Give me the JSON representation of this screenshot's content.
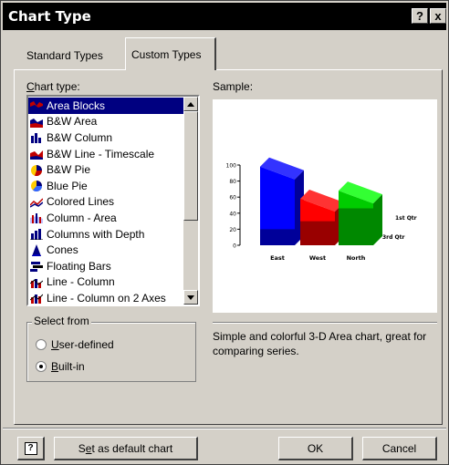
{
  "window": {
    "title": "Chart Type",
    "help_label": "?",
    "close_label": "x"
  },
  "tabs": [
    {
      "label": "Standard Types",
      "active": false
    },
    {
      "label": "Custom Types",
      "active": true
    }
  ],
  "chart_type_list": {
    "label_prefix": "C",
    "label_rest": "hart type:",
    "items": [
      {
        "label": "Area Blocks",
        "icon": "area-blocks-icon",
        "selected": true
      },
      {
        "label": "B&W Area",
        "icon": "bw-area-icon"
      },
      {
        "label": "B&W Column",
        "icon": "bw-column-icon"
      },
      {
        "label": "B&W Line - Timescale",
        "icon": "bw-line-timescale-icon"
      },
      {
        "label": "B&W Pie",
        "icon": "bw-pie-icon"
      },
      {
        "label": "Blue Pie",
        "icon": "blue-pie-icon"
      },
      {
        "label": "Colored Lines",
        "icon": "colored-lines-icon"
      },
      {
        "label": "Column - Area",
        "icon": "column-area-icon"
      },
      {
        "label": "Columns with Depth",
        "icon": "columns-depth-icon"
      },
      {
        "label": "Cones",
        "icon": "cones-icon"
      },
      {
        "label": "Floating Bars",
        "icon": "floating-bars-icon"
      },
      {
        "label": "Line - Column",
        "icon": "line-column-icon"
      },
      {
        "label": "Line - Column on 2 Axes",
        "icon": "line-column-2axes-icon"
      }
    ]
  },
  "sample": {
    "label": "Sample:",
    "chart_data": {
      "type": "area",
      "categories": [
        "East",
        "West",
        "North"
      ],
      "series": [
        {
          "name": "1st Qtr",
          "values": [
            98,
            58,
            68
          ],
          "color": "#0000ff"
        },
        {
          "name": "3rd Qtr",
          "values": [
            20,
            30,
            46
          ],
          "color": "#ff0000"
        }
      ],
      "ylim": [
        0,
        100
      ],
      "yticks": [
        "100",
        "80",
        "60",
        "40",
        "20",
        "0"
      ],
      "legend": "right",
      "block_colors": [
        "#0000ff",
        "#ff0000",
        "#00cc00"
      ]
    }
  },
  "select_from": {
    "title": "Select from",
    "options": [
      {
        "label_prefix": "",
        "label_u": "U",
        "label_rest": "ser-defined",
        "checked": false
      },
      {
        "label_prefix": "",
        "label_u": "B",
        "label_rest": "uilt-in",
        "checked": true
      }
    ]
  },
  "description": "Simple and colorful 3-D Area chart, great for comparing series.",
  "buttons": {
    "help": "?",
    "default_prefix": "S",
    "default_u": "e",
    "default_rest": "t as default chart",
    "ok": "OK",
    "cancel": "Cancel"
  }
}
